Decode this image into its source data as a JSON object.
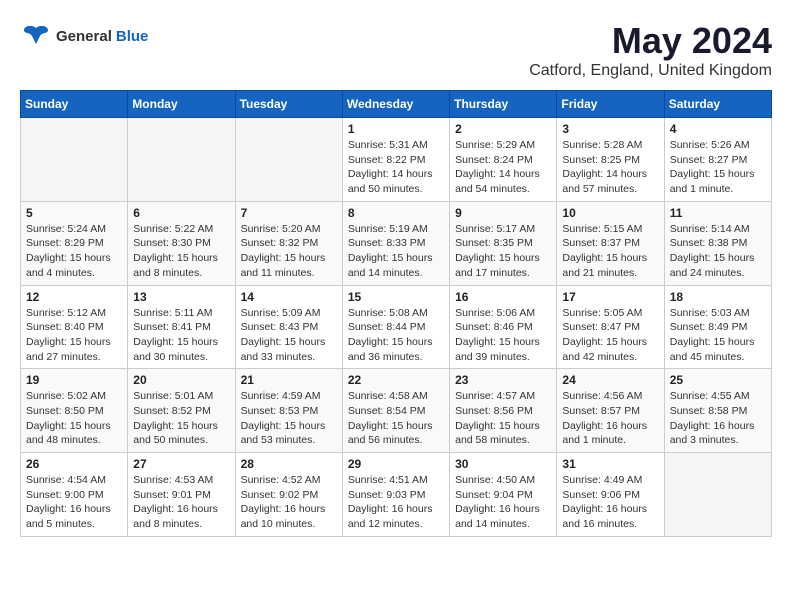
{
  "logo": {
    "general": "General",
    "blue": "Blue"
  },
  "title": "May 2024",
  "subtitle": "Catford, England, United Kingdom",
  "weekdays": [
    "Sunday",
    "Monday",
    "Tuesday",
    "Wednesday",
    "Thursday",
    "Friday",
    "Saturday"
  ],
  "weeks": [
    [
      {
        "day": "",
        "info": ""
      },
      {
        "day": "",
        "info": ""
      },
      {
        "day": "",
        "info": ""
      },
      {
        "day": "1",
        "info": "Sunrise: 5:31 AM\nSunset: 8:22 PM\nDaylight: 14 hours\nand 50 minutes."
      },
      {
        "day": "2",
        "info": "Sunrise: 5:29 AM\nSunset: 8:24 PM\nDaylight: 14 hours\nand 54 minutes."
      },
      {
        "day": "3",
        "info": "Sunrise: 5:28 AM\nSunset: 8:25 PM\nDaylight: 14 hours\nand 57 minutes."
      },
      {
        "day": "4",
        "info": "Sunrise: 5:26 AM\nSunset: 8:27 PM\nDaylight: 15 hours\nand 1 minute."
      }
    ],
    [
      {
        "day": "5",
        "info": "Sunrise: 5:24 AM\nSunset: 8:29 PM\nDaylight: 15 hours\nand 4 minutes."
      },
      {
        "day": "6",
        "info": "Sunrise: 5:22 AM\nSunset: 8:30 PM\nDaylight: 15 hours\nand 8 minutes."
      },
      {
        "day": "7",
        "info": "Sunrise: 5:20 AM\nSunset: 8:32 PM\nDaylight: 15 hours\nand 11 minutes."
      },
      {
        "day": "8",
        "info": "Sunrise: 5:19 AM\nSunset: 8:33 PM\nDaylight: 15 hours\nand 14 minutes."
      },
      {
        "day": "9",
        "info": "Sunrise: 5:17 AM\nSunset: 8:35 PM\nDaylight: 15 hours\nand 17 minutes."
      },
      {
        "day": "10",
        "info": "Sunrise: 5:15 AM\nSunset: 8:37 PM\nDaylight: 15 hours\nand 21 minutes."
      },
      {
        "day": "11",
        "info": "Sunrise: 5:14 AM\nSunset: 8:38 PM\nDaylight: 15 hours\nand 24 minutes."
      }
    ],
    [
      {
        "day": "12",
        "info": "Sunrise: 5:12 AM\nSunset: 8:40 PM\nDaylight: 15 hours\nand 27 minutes."
      },
      {
        "day": "13",
        "info": "Sunrise: 5:11 AM\nSunset: 8:41 PM\nDaylight: 15 hours\nand 30 minutes."
      },
      {
        "day": "14",
        "info": "Sunrise: 5:09 AM\nSunset: 8:43 PM\nDaylight: 15 hours\nand 33 minutes."
      },
      {
        "day": "15",
        "info": "Sunrise: 5:08 AM\nSunset: 8:44 PM\nDaylight: 15 hours\nand 36 minutes."
      },
      {
        "day": "16",
        "info": "Sunrise: 5:06 AM\nSunset: 8:46 PM\nDaylight: 15 hours\nand 39 minutes."
      },
      {
        "day": "17",
        "info": "Sunrise: 5:05 AM\nSunset: 8:47 PM\nDaylight: 15 hours\nand 42 minutes."
      },
      {
        "day": "18",
        "info": "Sunrise: 5:03 AM\nSunset: 8:49 PM\nDaylight: 15 hours\nand 45 minutes."
      }
    ],
    [
      {
        "day": "19",
        "info": "Sunrise: 5:02 AM\nSunset: 8:50 PM\nDaylight: 15 hours\nand 48 minutes."
      },
      {
        "day": "20",
        "info": "Sunrise: 5:01 AM\nSunset: 8:52 PM\nDaylight: 15 hours\nand 50 minutes."
      },
      {
        "day": "21",
        "info": "Sunrise: 4:59 AM\nSunset: 8:53 PM\nDaylight: 15 hours\nand 53 minutes."
      },
      {
        "day": "22",
        "info": "Sunrise: 4:58 AM\nSunset: 8:54 PM\nDaylight: 15 hours\nand 56 minutes."
      },
      {
        "day": "23",
        "info": "Sunrise: 4:57 AM\nSunset: 8:56 PM\nDaylight: 15 hours\nand 58 minutes."
      },
      {
        "day": "24",
        "info": "Sunrise: 4:56 AM\nSunset: 8:57 PM\nDaylight: 16 hours\nand 1 minute."
      },
      {
        "day": "25",
        "info": "Sunrise: 4:55 AM\nSunset: 8:58 PM\nDaylight: 16 hours\nand 3 minutes."
      }
    ],
    [
      {
        "day": "26",
        "info": "Sunrise: 4:54 AM\nSunset: 9:00 PM\nDaylight: 16 hours\nand 5 minutes."
      },
      {
        "day": "27",
        "info": "Sunrise: 4:53 AM\nSunset: 9:01 PM\nDaylight: 16 hours\nand 8 minutes."
      },
      {
        "day": "28",
        "info": "Sunrise: 4:52 AM\nSunset: 9:02 PM\nDaylight: 16 hours\nand 10 minutes."
      },
      {
        "day": "29",
        "info": "Sunrise: 4:51 AM\nSunset: 9:03 PM\nDaylight: 16 hours\nand 12 minutes."
      },
      {
        "day": "30",
        "info": "Sunrise: 4:50 AM\nSunset: 9:04 PM\nDaylight: 16 hours\nand 14 minutes."
      },
      {
        "day": "31",
        "info": "Sunrise: 4:49 AM\nSunset: 9:06 PM\nDaylight: 16 hours\nand 16 minutes."
      },
      {
        "day": "",
        "info": ""
      }
    ]
  ]
}
